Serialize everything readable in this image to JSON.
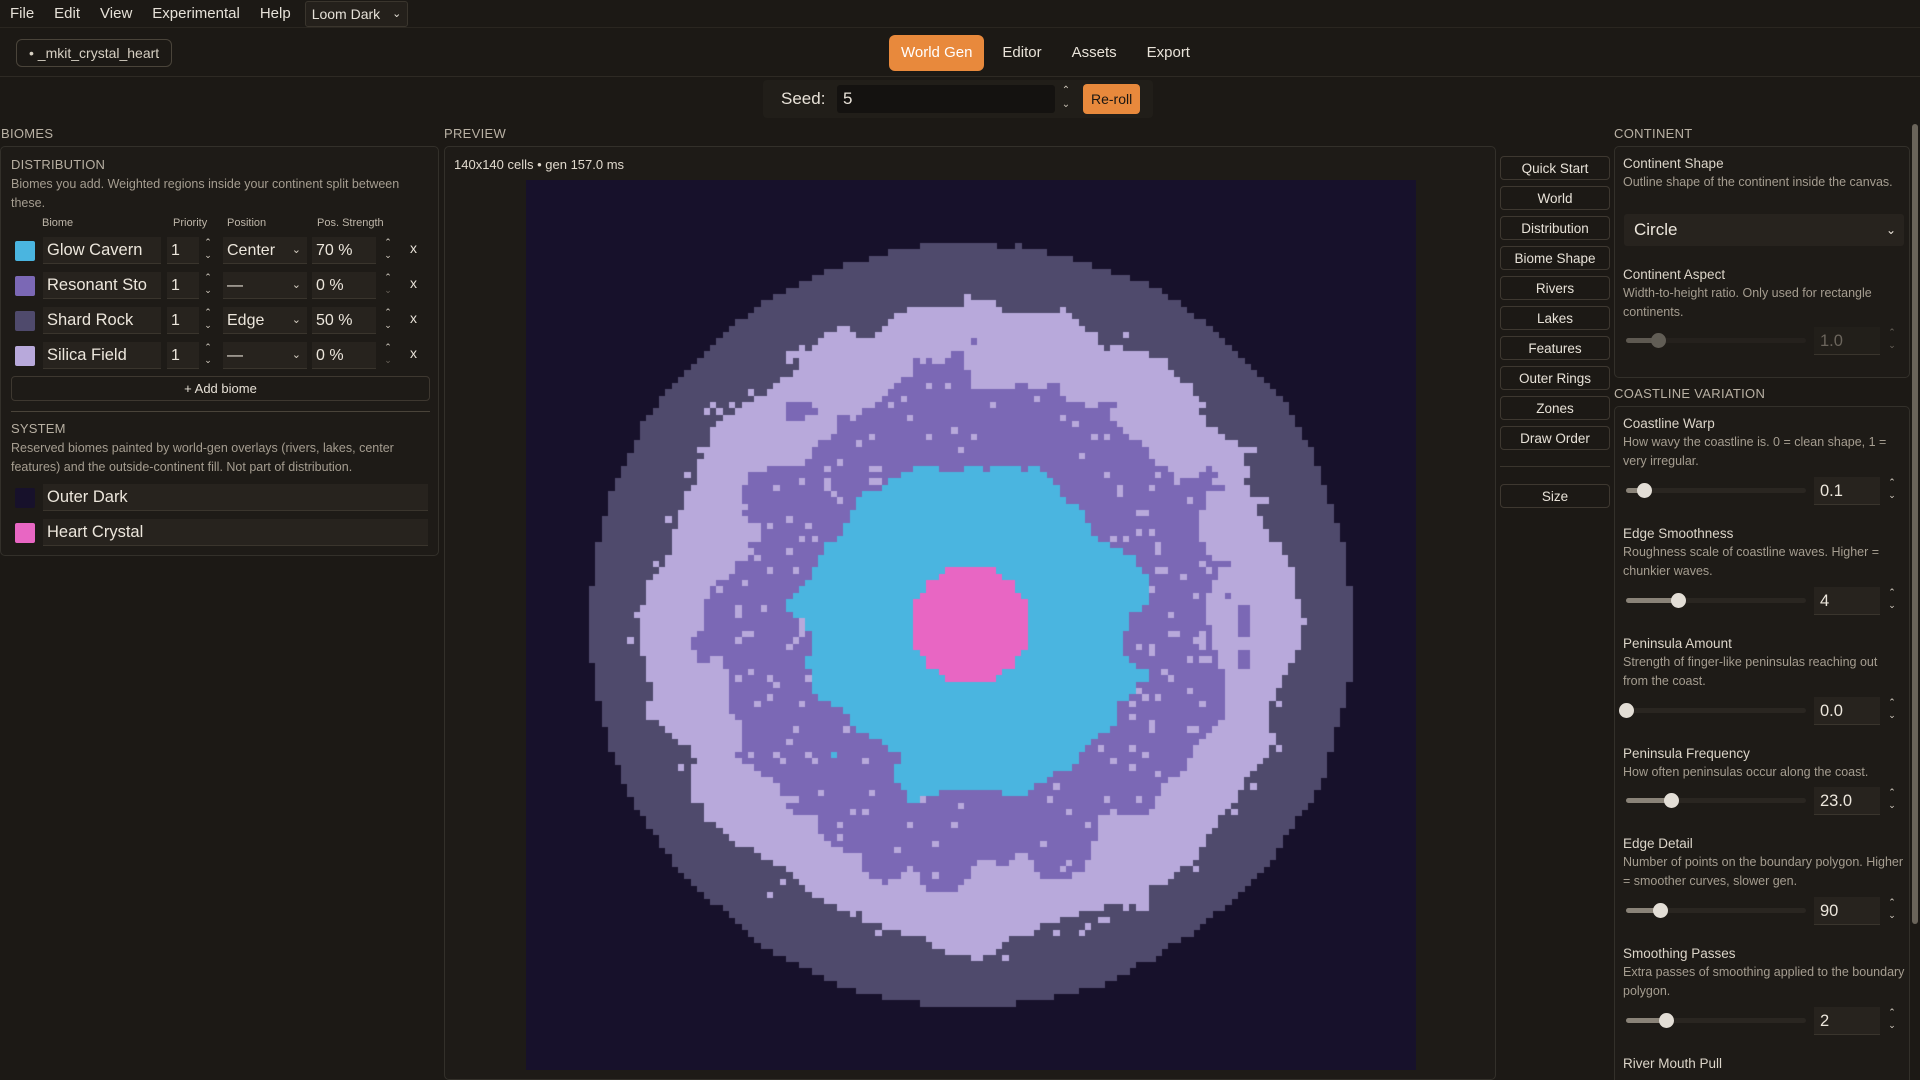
{
  "menu": {
    "file": "File",
    "edit": "Edit",
    "view": "View",
    "experimental": "Experimental",
    "help": "Help",
    "theme": "Loom Dark"
  },
  "toolbar": {
    "project_tab": "• _mkit_crystal_heart",
    "tabs": [
      "World Gen",
      "Editor",
      "Assets",
      "Export"
    ],
    "active_tab": "World Gen"
  },
  "seed": {
    "label": "Seed:",
    "value": "5",
    "reroll": "Re-roll"
  },
  "biomes": {
    "heading": "BIOMES",
    "distribution": {
      "heading": "DISTRIBUTION",
      "help": "Biomes you add. Weighted regions inside your continent split between these.",
      "columns": {
        "biome": "Biome",
        "priority": "Priority",
        "position": "Position",
        "strength": "Pos. Strength"
      },
      "rows": [
        {
          "name": "Glow Cavern",
          "color": "#4ab5e0",
          "priority": "1",
          "position": "Center",
          "strength": "70 %"
        },
        {
          "name": "Resonant Sto",
          "color": "#7b68b5",
          "priority": "1",
          "position": "—",
          "strength": "0 %"
        },
        {
          "name": "Shard Rock",
          "color": "#4f4a6c",
          "priority": "1",
          "position": "Edge",
          "strength": "50 %"
        },
        {
          "name": "Silica Field",
          "color": "#b8a9db",
          "priority": "1",
          "position": "—",
          "strength": "0 %"
        }
      ],
      "remove_label": "x",
      "add_button": "+ Add biome"
    },
    "system": {
      "heading": "SYSTEM",
      "help": "Reserved biomes painted by world-gen overlays (rivers, lakes, center features) and the outside-continent fill. Not part of distribution.",
      "rows": [
        {
          "name": "Outer Dark",
          "color": "#17112b"
        },
        {
          "name": "Heart Crystal",
          "color": "#e866c3"
        }
      ]
    }
  },
  "preview": {
    "heading": "PREVIEW",
    "meta": "140x140 cells • gen 157.0 ms",
    "colors": {
      "background": "#17112b",
      "shard_rock": "#4f4a6c",
      "silica_field": "#b8a9db",
      "resonant_stone": "#7b68b5",
      "glow_cavern": "#4ab5e0",
      "heart_crystal": "#e866c3"
    }
  },
  "side_nav": {
    "items": [
      "Quick Start",
      "World",
      "Distribution",
      "Biome Shape",
      "Rivers",
      "Lakes",
      "Features",
      "Outer Rings",
      "Zones",
      "Draw Order"
    ],
    "size": "Size"
  },
  "continent": {
    "heading": "CONTINENT",
    "shape": {
      "title": "Continent Shape",
      "help": "Outline shape of the continent inside the canvas.",
      "value": "Circle"
    },
    "aspect": {
      "title": "Continent Aspect",
      "help": "Width-to-height ratio. Only used for rectangle continents.",
      "value": "1.0",
      "level": 0.18
    }
  },
  "coastline": {
    "heading": "COASTLINE VARIATION",
    "controls": [
      {
        "title": "Coastline Warp",
        "help": "How wavy the coastline is. 0 = clean shape, 1 = very irregular.",
        "value": "0.1",
        "level": 0.1
      },
      {
        "title": "Edge Smoothness",
        "help": "Roughness scale of coastline waves. Higher = chunkier waves.",
        "value": "4",
        "level": 0.29
      },
      {
        "title": "Peninsula Amount",
        "help": "Strength of finger-like peninsulas reaching out from the coast.",
        "value": "0.0",
        "level": 0.0
      },
      {
        "title": "Peninsula Frequency",
        "help": "How often peninsulas occur along the coast.",
        "value": "23.0",
        "level": 0.25
      },
      {
        "title": "Edge Detail",
        "help": "Number of points on the boundary polygon. Higher = smoother curves, slower gen.",
        "value": "90",
        "level": 0.19
      },
      {
        "title": "Smoothing Passes",
        "help": "Extra passes of smoothing applied to the boundary polygon.",
        "value": "2",
        "level": 0.22
      }
    ],
    "next_title": "River Mouth Pull"
  }
}
